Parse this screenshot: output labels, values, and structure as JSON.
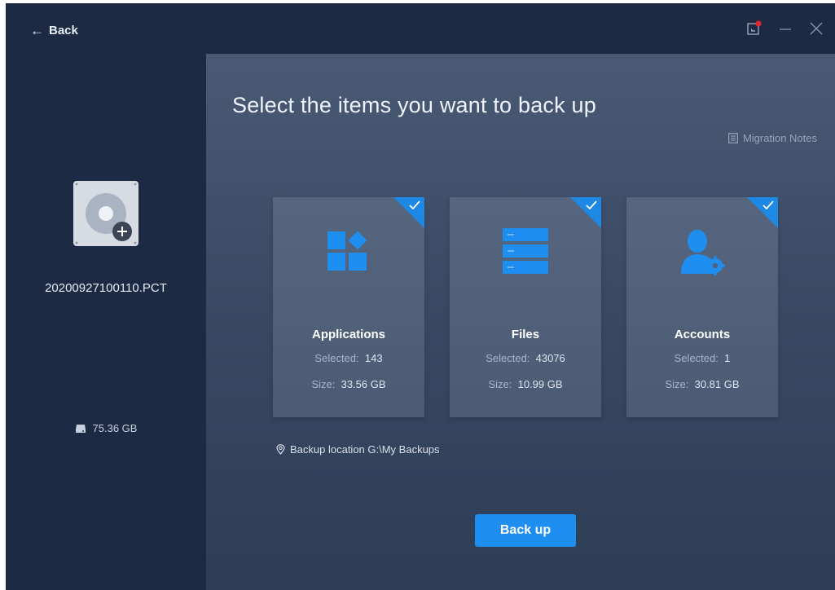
{
  "titlebar": {
    "back_label": "Back"
  },
  "sidebar": {
    "filename": "20200927100110.PCT",
    "disk_size": "75.36 GB"
  },
  "main": {
    "title": "Select the items you want to back up",
    "migration_notes": "Migration Notes",
    "cards": [
      {
        "title": "Applications",
        "selected_label": "Selected:",
        "selected": "143",
        "size_label": "Size:",
        "size": "33.56 GB",
        "checked": true,
        "icon": "applications-icon"
      },
      {
        "title": "Files",
        "selected_label": "Selected:",
        "selected": "43076",
        "size_label": "Size:",
        "size": "10.99 GB",
        "checked": true,
        "icon": "files-icon"
      },
      {
        "title": "Accounts",
        "selected_label": "Selected:",
        "selected": "1",
        "size_label": "Size:",
        "size": "30.81 GB",
        "checked": true,
        "icon": "accounts-icon"
      }
    ],
    "backup_location": "Backup location G:\\My Backups",
    "backup_button": "Back up"
  },
  "colors": {
    "accent": "#1f8ef1",
    "sidebar_bg": "#1c2b43",
    "card_bg": "#52627b",
    "notification_dot": "#e0262d"
  }
}
